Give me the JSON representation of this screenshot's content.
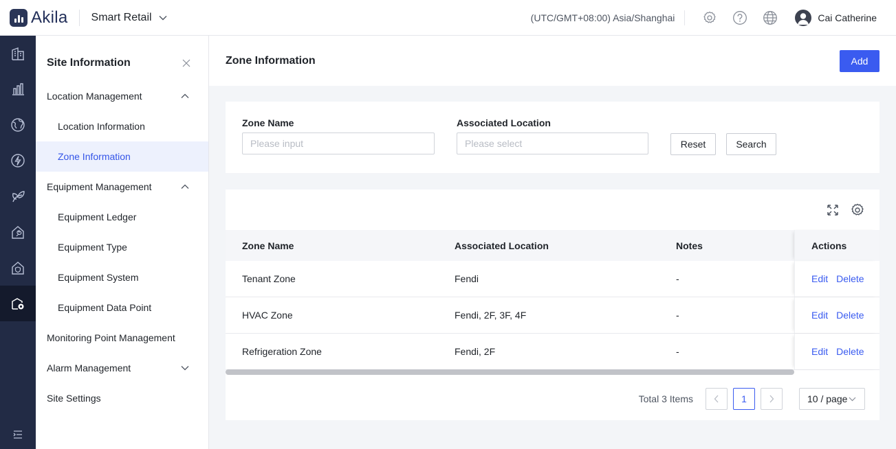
{
  "header": {
    "logo_text": "Akila",
    "app_name": "Smart Retail",
    "timezone": "(UTC/GMT+08:00) Asia/Shanghai",
    "icons": [
      "gear-icon",
      "help-icon",
      "globe-icon"
    ],
    "user_name": "Cai Catherine"
  },
  "rail": {
    "items": [
      "building-icon",
      "bar-chart-icon",
      "globe-icon",
      "energy-icon",
      "leaf-icon",
      "maintenance-icon",
      "home-shield-icon",
      "site-settings-icon"
    ],
    "active_index": 7,
    "collapse_icon": "menu-collapse-icon"
  },
  "subnav": {
    "title": "Site Information",
    "items": [
      {
        "label": "Location Management",
        "level": 1,
        "expand": "up"
      },
      {
        "label": "Location Information",
        "level": 2
      },
      {
        "label": "Zone Information",
        "level": 2,
        "active": true
      },
      {
        "label": "Equipment Management",
        "level": 1,
        "expand": "up"
      },
      {
        "label": "Equipment Ledger",
        "level": 2
      },
      {
        "label": "Equipment Type",
        "level": 2
      },
      {
        "label": "Equipment System",
        "level": 2
      },
      {
        "label": "Equipment Data Point",
        "level": 2
      },
      {
        "label": "Monitoring Point Management",
        "level": 1
      },
      {
        "label": "Alarm Management",
        "level": 1,
        "expand": "down"
      },
      {
        "label": "Site Settings",
        "level": 1
      }
    ]
  },
  "page": {
    "title": "Zone Information",
    "add_label": "Add"
  },
  "filters": {
    "zone_name_label": "Zone Name",
    "zone_name_placeholder": "Please input",
    "location_label": "Associated Location",
    "location_placeholder": "Please select",
    "reset_label": "Reset",
    "search_label": "Search"
  },
  "table": {
    "columns": [
      "Zone Name",
      "Associated Location",
      "Notes",
      "Actions"
    ],
    "rows": [
      {
        "zone": "Tenant Zone",
        "location": "Fendi",
        "notes": "-"
      },
      {
        "zone": "HVAC Zone",
        "location": "Fendi, 2F, 3F, 4F",
        "notes": "-"
      },
      {
        "zone": "Refrigeration Zone",
        "location": "Fendi, 2F",
        "notes": "-"
      }
    ],
    "edit_label": "Edit",
    "delete_label": "Delete"
  },
  "pagination": {
    "total_text": "Total 3 Items",
    "current_page": "1",
    "page_size": "10 / page"
  },
  "colors": {
    "primary": "#3a5bf0",
    "rail_bg": "#222b45",
    "active_nav_bg": "#edf1fd"
  }
}
